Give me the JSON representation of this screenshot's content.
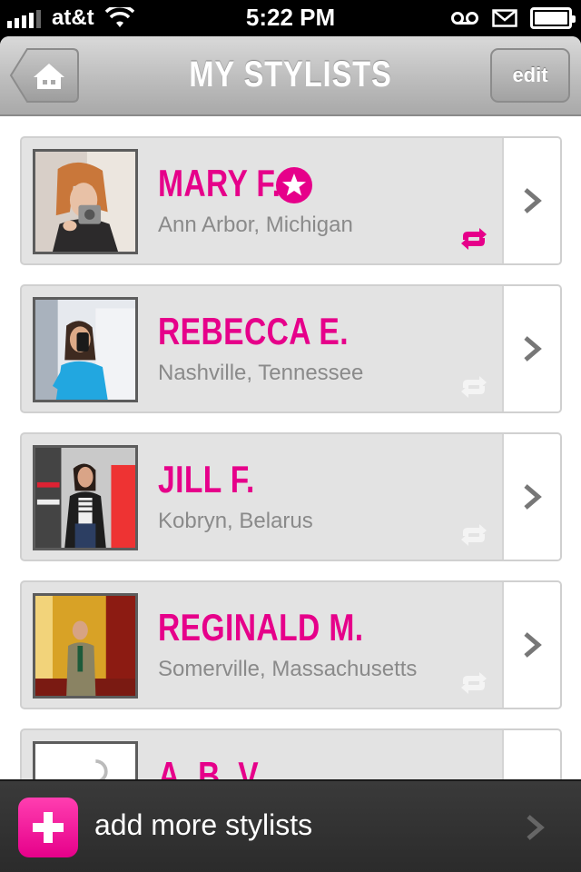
{
  "status_bar": {
    "carrier": "at&t",
    "time": "5:22 PM"
  },
  "nav": {
    "title": "MY STYLISTS",
    "edit_label": "edit"
  },
  "stylists": [
    {
      "name": "MARY F.",
      "location": "Ann Arbor, Michigan",
      "starred": true,
      "synced": true
    },
    {
      "name": "REBECCA E.",
      "location": "Nashville, Tennessee",
      "starred": false,
      "synced": false
    },
    {
      "name": "JILL F.",
      "location": "Kobryn, Belarus",
      "starred": false,
      "synced": false
    },
    {
      "name": "REGINALD M.",
      "location": "Somerville, Massachusetts",
      "starred": false,
      "synced": false
    },
    {
      "name": "A. B. V.",
      "location": "",
      "starred": false,
      "synced": false
    }
  ],
  "bottom_bar": {
    "add_label": "add more stylists"
  },
  "colors": {
    "accent_pink": "#e6008a",
    "location_gray": "#8a8a8a",
    "card_bg": "#e3e3e3"
  },
  "icons": {
    "home": "home-icon",
    "star": "star-badge-icon",
    "sync": "repeat-icon",
    "chevron": "chevron-right-icon",
    "add": "plus-icon"
  }
}
